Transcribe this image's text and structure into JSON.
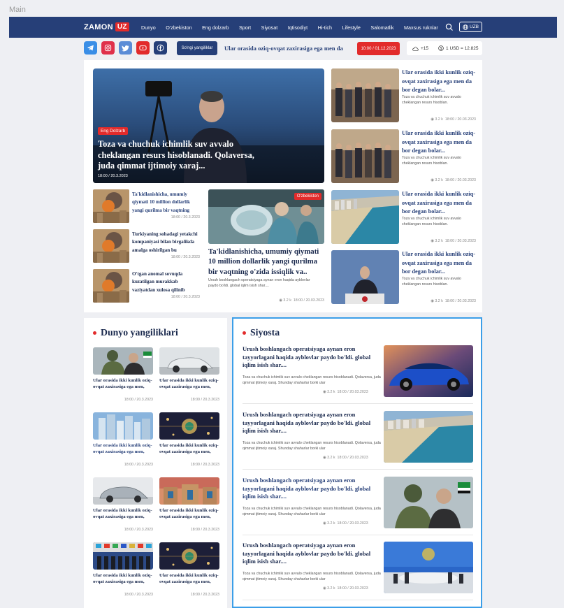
{
  "frame_label": "Main",
  "header": {
    "logo_text": "ZAMON",
    "logo_badge": "UZ",
    "nav": [
      "Dunyo",
      "O'zbekiston",
      "Eng dolzarb",
      "Sport",
      "Siyosat",
      "Iqtisodiyt",
      "Hi-tich",
      "Lifestyle",
      "Salomatlik",
      "Maxsus ruknlar"
    ],
    "lang": "UZB"
  },
  "topbar": {
    "latest_label": "So'ngi yangiliklar",
    "ticker": "Ular orasida  oziq-ovqat zaxirasiga ega men da",
    "ticker_date": "10:00 / 01.12.2023",
    "weather": "+15",
    "currency": "1 USD = 12.825"
  },
  "hero": {
    "tag": "Eng Dolzarb",
    "title": "Toza va chuchuk ichimlik suv avvalo cheklangan resurs hisoblanadi. Qolaversa, juda qimmat ijtimoiy xaraj...",
    "date": "18:00 / 20.3.2023"
  },
  "side_cards": [
    {
      "title": "Ular orasida ikki kunlik oziq-ovqat zaxirasiga ega men da bor degan bolar...",
      "desc": "Toza va chuchuk ichimlik suv avvalo cheklangan resurs hisoblan.",
      "views": "3.2 k",
      "date": "18:00 / 20.03.2023"
    },
    {
      "title": "Ular orasida ikki kunlik oziq-ovqat zaxirasiga ega men da bor degan bolar...",
      "desc": "Toza va chuchuk ichimlik suv avvalo cheklangan resurs hisoblan.",
      "views": "3.2 k",
      "date": "18:00 / 20.03.2023"
    },
    {
      "title": "Ular orasida ikki kunlik oziq-ovqat zaxirasiga ega men da bor degan bolar...",
      "desc": "Toza va chuchuk ichimlik suv avvalo cheklangan resurs hisoblan.",
      "views": "3.2 k",
      "date": "18:00 / 20.03.2023"
    },
    {
      "title": "Ular orasida ikki kunlik oziq-ovqat zaxirasiga ega men da bor degan bolar...",
      "desc": "Toza va chuchuk ichimlik suv avvalo cheklangan resurs hisoblan.",
      "views": "3.2 k",
      "date": "18:00 / 20.03.2023"
    }
  ],
  "small_cards": [
    {
      "title": "Ta'kidlanishicha, umumiy qiymati 10 million dollarlik yangi qurilma bir vaqtning",
      "date": "18:00 / 20.3.2023"
    },
    {
      "title": "Turkiyaning sohadagi yetakchi kompaniyasi bilan birgalikda amalga oshirilgan bu",
      "date": "18:00 / 20.3.2023"
    },
    {
      "title": "O'tgan anomal sovuqda kuzatilgan murakkab vaziyatdan xulosa qilinib",
      "date": "18:00 / 20.3.2023"
    }
  ],
  "mid_card": {
    "tag": "O'zbekiston",
    "title": "Ta'kidlanishicha, umumiy qiymati 10 million dollarlik yangi qurilma bir vaqtning o'zida issiqlik va..",
    "desc": "Ursuh boshlangach operatsiyaga aynan eron haqida ayblovlar paydo bo'ldi. global iqlim isish shar....",
    "views": "3.2 k",
    "date": "18:00 / 20.03.2023"
  },
  "dunyo": {
    "title": "Dunyo yangiliklari",
    "items": [
      {
        "title": "Ular orasida ikki kunlik oziq-ovqat zaxirasiga ega men,",
        "date": "18:00 / 20.3.2023"
      },
      {
        "title": "Ular orasida ikki kunlik oziq-ovqat zaxirasiga ega men,",
        "date": "18:00 / 20.3.2023"
      },
      {
        "title": "Ular orasida ikki kunlik oziq-ovqat zaxirasiga ega men,",
        "date": "18:00 / 20.3.2023"
      },
      {
        "title": "Ular orasida ikki kunlik oziq-ovqat zaxirasiga ega men,",
        "date": "18:00 / 20.3.2023"
      },
      {
        "title": "Ular orasida ikki kunlik oziq-ovqat zaxirasiga ega men,",
        "date": "18:00 / 20.3.2023"
      },
      {
        "title": "Ular orasida ikki kunlik oziq-ovqat zaxirasiga ega men,",
        "date": "18:00 / 20.3.2023"
      },
      {
        "title": "Ular orasida ikki kunlik oziq-ovqat zaxirasiga ega men,",
        "date": "18:00 / 20.3.2023"
      },
      {
        "title": "Ular orasida ikki kunlik oziq-ovqat zaxirasiga ega men,",
        "date": "18:00 / 20.3.2023"
      }
    ]
  },
  "siyosta": {
    "title": "Siyosta",
    "items": [
      {
        "title": "Urush boshlangach operatsiyaga aynan eron tayyorlagani haqida ayblovlar paydo bo'ldi. global iqlim isish shar....",
        "desc": "Toza va chuchuk ichimlik suv avvalo cheklangan resurs hisoblanadi. Qolaversa, juda qimmat ijtimoiy xaraj. Shunday shaharlar borki ular",
        "views": "3.2 k",
        "date": "18:00 / 20.03.2023"
      },
      {
        "title": "Urush boshlangach operatsiyaga aynan eron tayyorlagani haqida ayblovlar paydo bo'ldi. global iqlim isish shar....",
        "desc": "Toza va chuchuk ichimlik suv avvalo cheklangan resurs hisoblanadi. Qolaversa, juda qimmat ijtimoiy xaraj. Shunday shaharlar borki ular",
        "views": "3.2 k",
        "date": "18:00 / 20.03.2023"
      },
      {
        "title": "Urush boshlangach operatsiyaga aynan eron tayyorlagani haqida ayblovlar paydo bo'ldi. global iqlim isish shar....",
        "desc": "Toza va chuchuk ichimlik suv avvalo cheklangan resurs hisoblanadi. Qolaversa, juda qimmat ijtimoiy xaraj. Shunday shaharlar borki ular",
        "views": "3.2 k",
        "date": "18:00 / 20.03.2023"
      },
      {
        "title": "Urush boshlangach operatsiyaga aynan eron tayyorlagani haqida ayblovlar paydo bo'ldi. global iqlim isish shar....",
        "desc": "Toza va chuchuk ichimlik suv avvalo cheklangan resurs hisoblanadi. Qolaversa, juda qimmat ijtimoiy xaraj. Shunday shaharlar borki ular",
        "views": "3.2 k",
        "date": "18:00 / 20.03.2023"
      }
    ]
  },
  "colors": {
    "brand": "#263f78",
    "accent": "#e22b2b",
    "focus": "#3b9ee8"
  }
}
